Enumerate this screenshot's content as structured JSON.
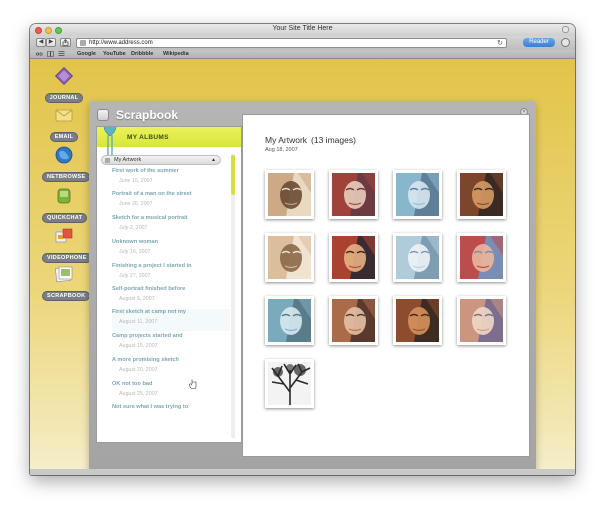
{
  "browser": {
    "window_title": "Your Site Title Here",
    "url": "http://www.address.com",
    "reader_label": "Reader",
    "back_glyph": "◀",
    "forward_glyph": "▶",
    "reload_glyph": "↻",
    "bookmarks": [
      "Google",
      "YouTube",
      "Dribbble",
      "Wikipedia"
    ]
  },
  "dock": {
    "items": [
      {
        "label": "JOURNAL",
        "icon": "journal-icon"
      },
      {
        "label": "EMAIL",
        "icon": "email-icon"
      },
      {
        "label": "NETBROWSE",
        "icon": "netbrowse-icon"
      },
      {
        "label": "QUICKCHAT",
        "icon": "quickchat-icon"
      },
      {
        "label": "VIDEOPHONE",
        "icon": "videophone-icon"
      },
      {
        "label": "SCRAPBOOK",
        "icon": "scrapbook-icon"
      }
    ]
  },
  "panel": {
    "title": "Scrapbook",
    "close_glyph": "×"
  },
  "albums": {
    "heading": "MY ALBUMS",
    "selected_album": "My Artwork",
    "select_arrow": "▲",
    "entries": [
      {
        "title": "First work of the summer",
        "date": "June 15, 2007"
      },
      {
        "title": "Portrait of a man on the street",
        "date": "June 26, 2007"
      },
      {
        "title": "Sketch for a musical portrait",
        "date": "July 2, 2007"
      },
      {
        "title": "Unknown woman",
        "date": "July 16, 2007"
      },
      {
        "title": "Finishing a project I started in",
        "date": "July 27, 2007"
      },
      {
        "title": "Self-portrait finished before",
        "date": "August 5, 2007"
      },
      {
        "title": "First sketch at camp  not my",
        "date": "August 11, 2007"
      },
      {
        "title": "Camp projects started and",
        "date": "August 15, 2007"
      },
      {
        "title": "A more promising sketch",
        "date": "August 20, 2007"
      },
      {
        "title": "OK not too bad",
        "date": "August 25, 2007"
      },
      {
        "title": "Not sure what I was trying to",
        "date": ""
      }
    ]
  },
  "artwork": {
    "title": "My Artwork",
    "count": "(13 images)",
    "date": "Aug 18, 2007",
    "colors": [
      [
        "#c8a07a",
        "#6b4a35",
        "#e9d9c1"
      ],
      [
        "#a8453a",
        "#e7cdbd",
        "#6c3a40"
      ],
      [
        "#8fc0d6",
        "#d8e7ee",
        "#5f7f98"
      ],
      [
        "#8a4b2e",
        "#d79a62",
        "#3a2a22"
      ],
      [
        "#d7b793",
        "#8a6848",
        "#f0e3d0"
      ],
      [
        "#c0452f",
        "#e7b182",
        "#3a2b33"
      ],
      [
        "#b9d3e0",
        "#eef4f7",
        "#7d9db3"
      ],
      [
        "#c8423c",
        "#eab79b",
        "#7a8db6"
      ],
      [
        "#7fb4c4",
        "#d7e9ef",
        "#587c8a"
      ],
      [
        "#b9744e",
        "#e3c1a5",
        "#5b3a2e"
      ],
      [
        "#9a5230",
        "#d6925c",
        "#3e2b22"
      ],
      [
        "#d99c7c",
        "#efd7c7",
        "#7d6d8e"
      ],
      [
        "#2a2a2a",
        "#f3f3f3",
        "#777777"
      ]
    ]
  }
}
